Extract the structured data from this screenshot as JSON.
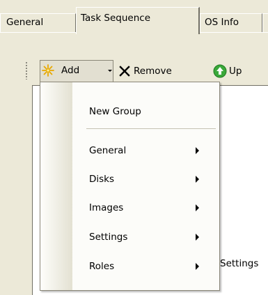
{
  "tabs": [
    {
      "label": "General",
      "active": false
    },
    {
      "label": "Task Sequence",
      "active": true
    },
    {
      "label": "OS Info",
      "active": false
    }
  ],
  "toolbar": {
    "add_label": "Add",
    "remove_label": "Remove",
    "up_label": "Up"
  },
  "menu": {
    "new_group_label": "New Group",
    "items": [
      {
        "label": "General"
      },
      {
        "label": "Disks"
      },
      {
        "label": "Images"
      },
      {
        "label": "Settings"
      },
      {
        "label": "Roles"
      }
    ]
  },
  "background_text": "Settings",
  "colors": {
    "face": "#ece9d8",
    "add_icon": "#e8a800",
    "remove_icon": "#000000",
    "up_icon": "#3aa83a",
    "menu_bg": "#fcfcf9"
  },
  "icons": {
    "add": "sparkle-add-icon",
    "remove": "x-remove-icon",
    "up": "green-up-arrow-icon",
    "dropdown": "caret-down-icon",
    "submenu": "submenu-arrow-icon"
  }
}
